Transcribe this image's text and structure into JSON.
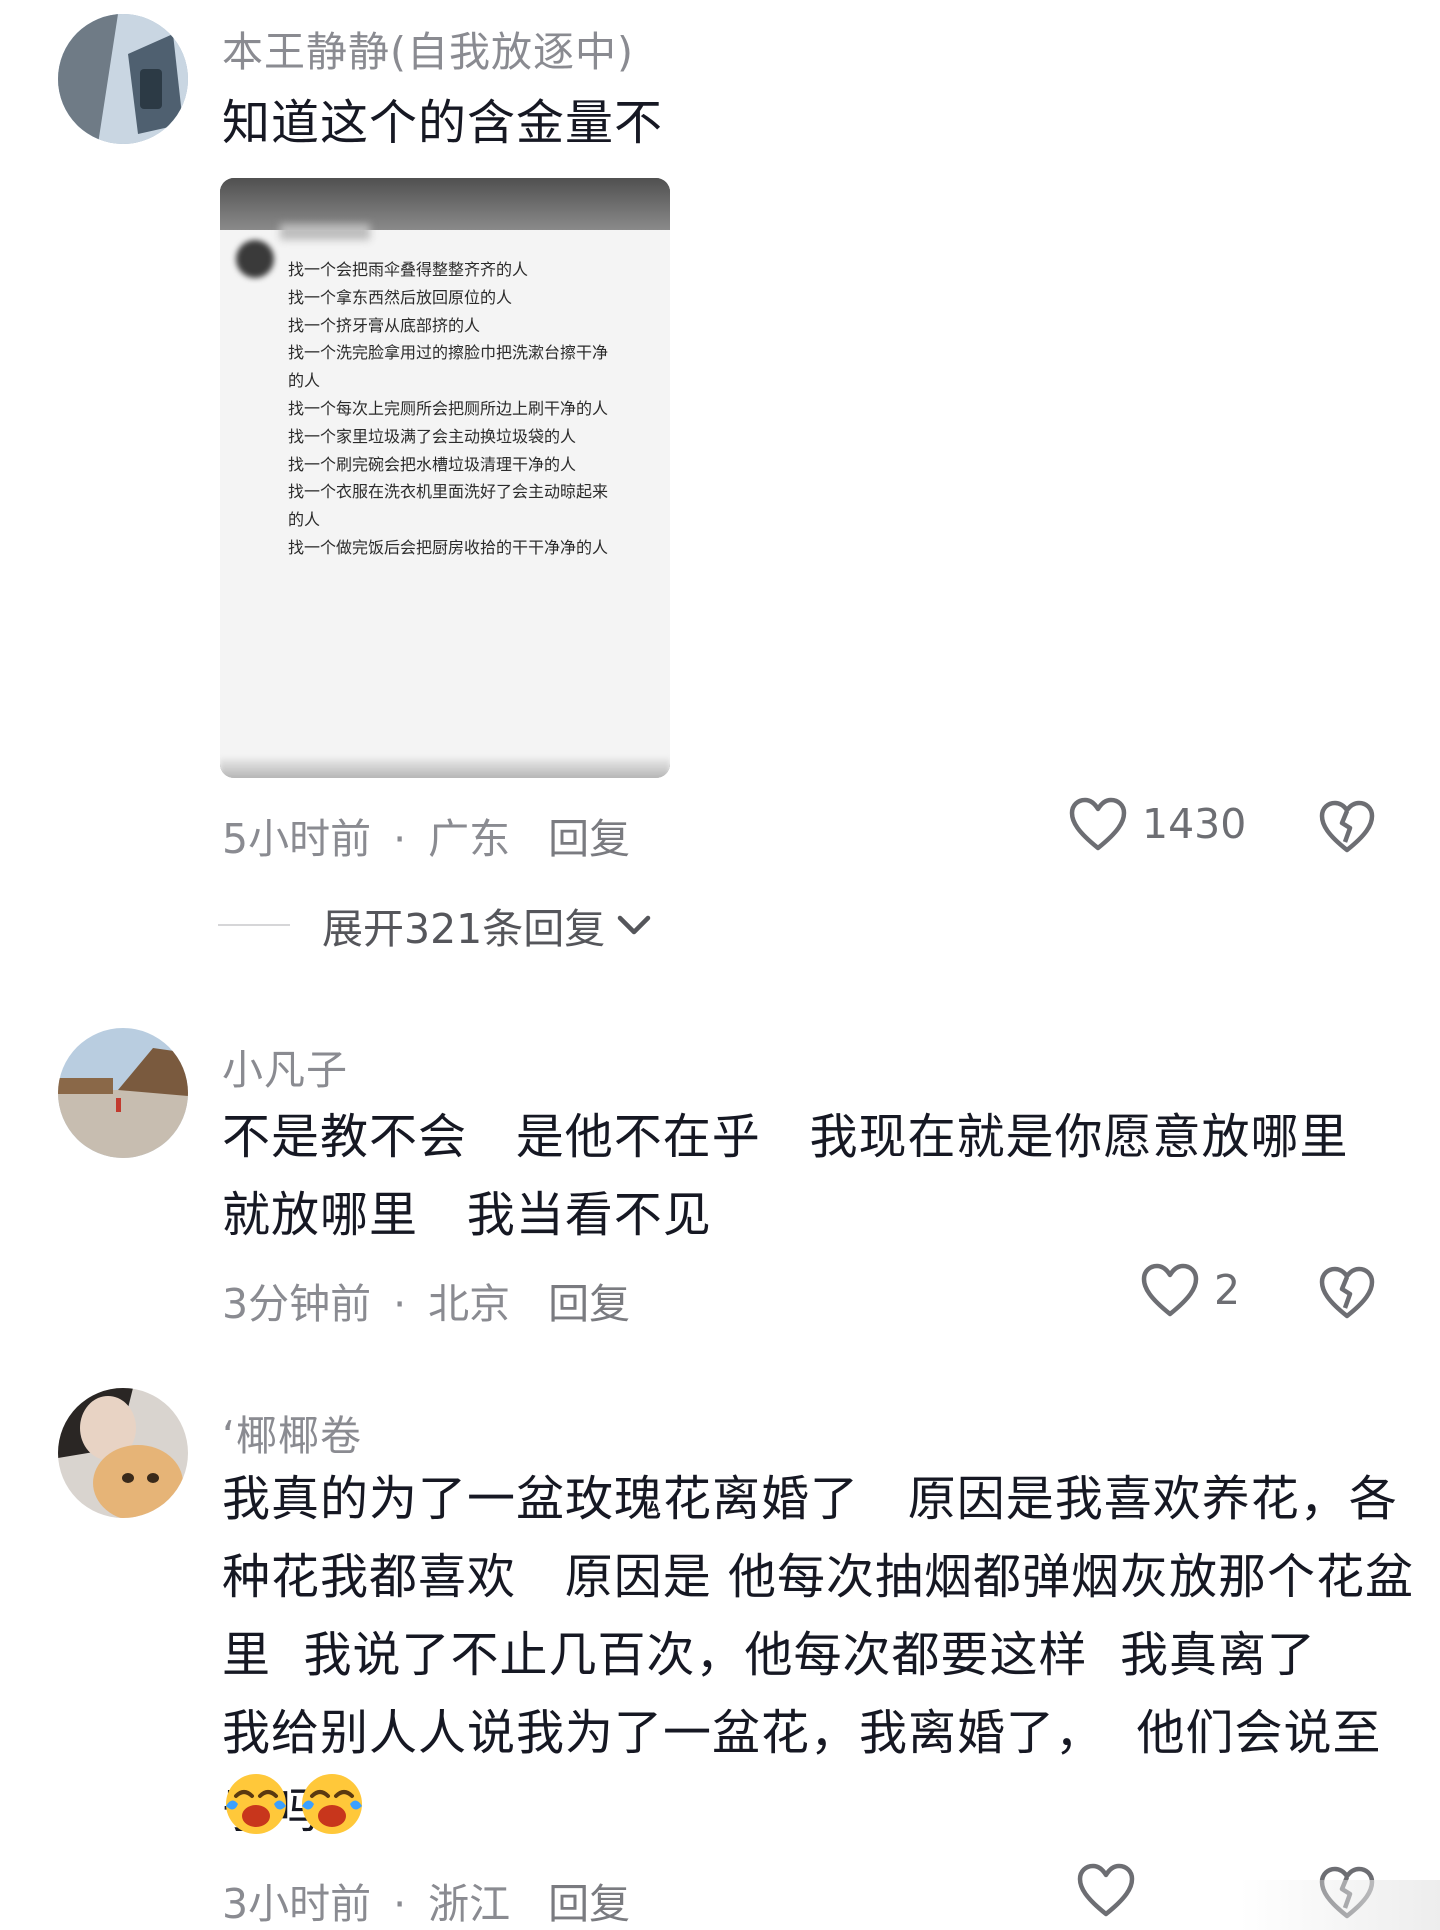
{
  "comments": [
    {
      "username": "本王静静(自我放逐中)",
      "text": "知道这个的含金量不",
      "image_lines": [
        "找一个会把雨伞叠得整整齐齐的人",
        "找一个拿东西然后放回原位的人",
        "找一个挤牙膏从底部挤的人",
        "找一个洗完脸拿用过的擦脸巾把洗漱台擦干净",
        "的人",
        "找一个每次上完厕所会把厕所边上刷干净的人",
        "找一个家里垃圾满了会主动换垃圾袋的人",
        "找一个刷完碗会把水槽垃圾清理干净的人",
        "找一个衣服在洗衣机里面洗好了会主动晾起来",
        "的人",
        "找一个做完饭后会把厨房收拾的干干净净的人"
      ],
      "time": "5小时前",
      "location": "广东",
      "reply": "回复",
      "likes": "1430",
      "expand_replies": "展开321条回复"
    },
    {
      "username": "小凡子",
      "text": "不是教不会   是他不在乎   我现在就是你愿意放哪里就放哪里   我当看不见",
      "time": "3分钟前",
      "location": "北京",
      "reply": "回复",
      "likes": "2"
    },
    {
      "username": "‘椰椰卷",
      "text": "我真的为了一盆玫瑰花离婚了   原因是我喜欢养花，各种花我都喜欢   原因是 他每次抽烟都弹烟灰放那个花盆里  我说了不止几百次，他每次都要这样  我真离了    我给别人人说我为了一盆花，我离婚了，  他们会说至于吗",
      "emojis": [
        "crying-laughing-emoji",
        "crying-laughing-emoji"
      ],
      "time": "3小时前",
      "location": "浙江",
      "reply": "回复"
    }
  ],
  "colors": {
    "text": "#161823",
    "secondary": "#8a8b91",
    "icon": "#6d6e73"
  }
}
